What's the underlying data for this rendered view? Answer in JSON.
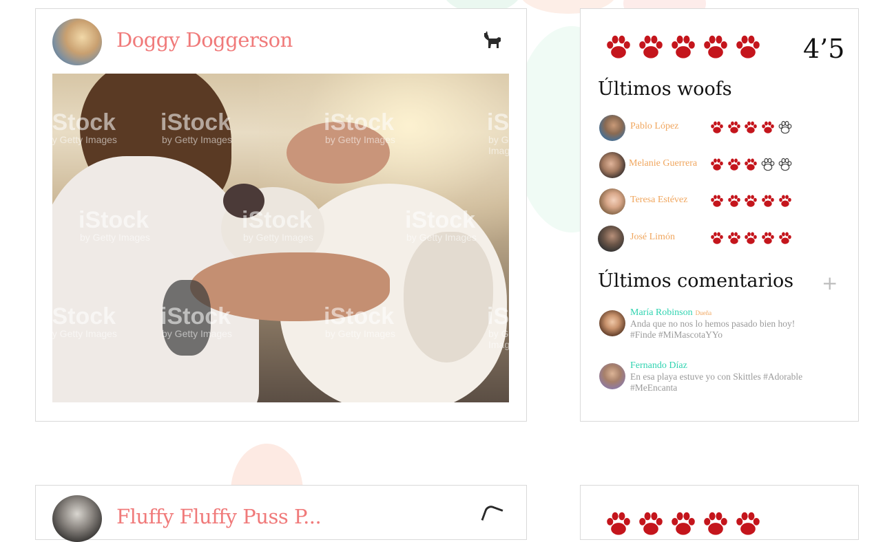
{
  "colors": {
    "pet_name": "#f07a7a",
    "paw_red": "#c4151c",
    "woof_name": "#f0a65e",
    "comment_name": "#2fd3b0",
    "comment_text": "#9a9a9a",
    "border": "#d9d9d9"
  },
  "post1": {
    "pet_name": "Doggy Doggerson",
    "avatar_icon": "owner-avatar",
    "type_icon": "dog-icon",
    "photo_watermark": "iStock",
    "photo_watermark_sub": "by Getty Images",
    "rating": {
      "paws_filled": 5,
      "paws_total": 5,
      "score": "4’5"
    },
    "woofs_title": "Últimos woofs",
    "woofs": [
      {
        "name": "Pablo López",
        "rating": 4
      },
      {
        "name": "Melanie Guerrera",
        "rating": 3
      },
      {
        "name": "Teresa Estévez",
        "rating": 5
      },
      {
        "name": "José Limón",
        "rating": 5
      }
    ],
    "comments_title": "Últimos comentarios",
    "add_comment_icon": "plus-icon",
    "comments": [
      {
        "name": "María Robinson",
        "role": "Dueña",
        "text_line1": "Anda que no nos lo hemos pasado bien hoy!",
        "text_line2": "#Finde #MiMascotaYYo"
      },
      {
        "name": "Fernando Díaz",
        "role": "",
        "text_line1": "En esa playa estuve yo con Skittles #Adorable",
        "text_line2": "#MeEncanta"
      }
    ]
  },
  "post2": {
    "pet_name": "Fluffy Fluffy Puss P..."
  }
}
